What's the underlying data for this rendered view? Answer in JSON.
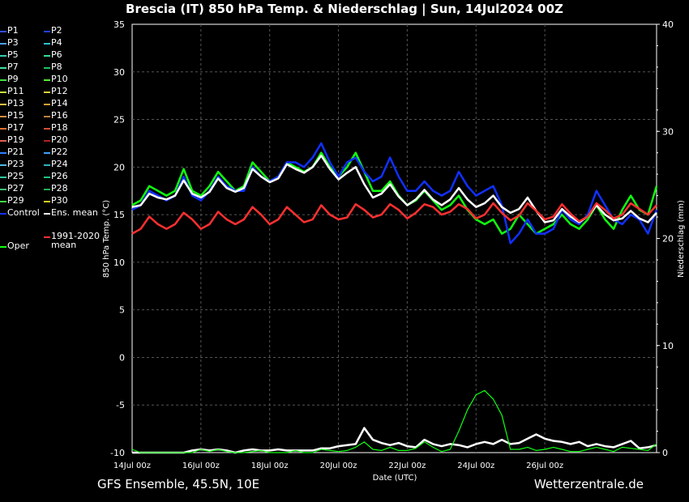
{
  "title": "Brescia  (IT)  850 hPa Temp. & Niederschlag | Sun, 14Jul2024 00Z",
  "footer": {
    "left": "GFS Ensemble, 45.5N, 10E",
    "right": "Wetterzentrale.de"
  },
  "legend": [
    {
      "name": "P1",
      "color": "#3050ff"
    },
    {
      "name": "P2",
      "color": "#2040e0"
    },
    {
      "name": "P3",
      "color": "#4aa0ff"
    },
    {
      "name": "P4",
      "color": "#30c0d0"
    },
    {
      "name": "P5",
      "color": "#30d0b0"
    },
    {
      "name": "P6",
      "color": "#30e090"
    },
    {
      "name": "P7",
      "color": "#40e0a0"
    },
    {
      "name": "P8",
      "color": "#20c060"
    },
    {
      "name": "P9",
      "color": "#40e040"
    },
    {
      "name": "P10",
      "color": "#50f030"
    },
    {
      "name": "P11",
      "color": "#c8e040"
    },
    {
      "name": "P12",
      "color": "#e0d040"
    },
    {
      "name": "P13",
      "color": "#e8c040"
    },
    {
      "name": "P14",
      "color": "#e0a030"
    },
    {
      "name": "P15",
      "color": "#e09040"
    },
    {
      "name": "P16",
      "color": "#c08040"
    },
    {
      "name": "P17",
      "color": "#e07030"
    },
    {
      "name": "P18",
      "color": "#d05030"
    },
    {
      "name": "P19",
      "color": "#e06050"
    },
    {
      "name": "P20",
      "color": "#b02020"
    },
    {
      "name": "P21",
      "color": "#3080ff"
    },
    {
      "name": "P22",
      "color": "#40a0ff"
    },
    {
      "name": "P23",
      "color": "#50b8e0"
    },
    {
      "name": "P24",
      "color": "#30b0c0"
    },
    {
      "name": "P25",
      "color": "#30c8a0"
    },
    {
      "name": "P26",
      "color": "#20c080"
    },
    {
      "name": "P27",
      "color": "#40c070"
    },
    {
      "name": "P28",
      "color": "#20b050"
    },
    {
      "name": "P29",
      "color": "#40e040"
    },
    {
      "name": "P30",
      "color": "#e0d020"
    },
    {
      "name": "Control",
      "color": "#1030ff"
    },
    {
      "name": "Ens. mean",
      "color": "#ffffff"
    },
    {
      "name": "Oper",
      "color": "#10ff10"
    },
    {
      "name": "1991-2020\nmean",
      "color": "#ff3030"
    }
  ],
  "chart_data": {
    "type": "line",
    "xlabel": "Date (UTC)",
    "ylabel": "850 hPa Temp. (°C)",
    "ylabel_right": "Niederschlag (mm)",
    "ylim": [
      -10,
      35
    ],
    "ylim_right": [
      0,
      40
    ],
    "yticks": [
      "35",
      "30",
      "25",
      "20",
      "15",
      "10",
      "5",
      "0",
      "-5",
      "-10"
    ],
    "yticks_right": [
      "40",
      "30",
      "20",
      "10",
      "0"
    ],
    "xticks": [
      "14Jul 00z",
      "16Jul 00z",
      "18Jul 00z",
      "20Jul 00z",
      "22Jul 00z",
      "24Jul 00z",
      "26Jul 00z"
    ],
    "x_start": "14Jul 00z",
    "x_step_hours": 6,
    "grid": true,
    "series": [
      {
        "name": "Oper",
        "color": "#10ff10",
        "values": [
          16.0,
          16.5,
          18.0,
          17.5,
          17.0,
          17.5,
          19.8,
          17.5,
          17.0,
          18.0,
          19.5,
          18.5,
          17.5,
          18.0,
          20.5,
          19.5,
          18.5,
          19.0,
          20.5,
          20.0,
          19.5,
          20.0,
          21.5,
          20.0,
          19.0,
          20.0,
          21.5,
          19.5,
          17.5,
          17.5,
          18.5,
          17.0,
          16.0,
          16.5,
          17.5,
          16.5,
          15.5,
          16.0,
          17.0,
          15.5,
          14.5,
          14.0,
          14.5,
          13.0,
          13.5,
          15.0,
          14.0,
          13.0,
          13.5,
          14.0,
          15.0,
          14.0,
          13.5,
          14.5,
          16.0,
          14.5,
          13.5,
          15.5,
          17.0,
          15.5,
          15.0,
          18.0
        ]
      },
      {
        "name": "Control",
        "color": "#1030ff",
        "values": [
          15.5,
          16.0,
          17.5,
          17.0,
          16.5,
          17.0,
          19.0,
          17.0,
          16.5,
          17.5,
          19.0,
          18.0,
          17.5,
          17.5,
          20.0,
          19.0,
          18.5,
          19.0,
          20.5,
          20.5,
          20.0,
          21.0,
          22.5,
          20.5,
          19.0,
          20.5,
          21.0,
          19.5,
          18.5,
          19.0,
          21.0,
          19.0,
          17.5,
          17.5,
          18.5,
          17.5,
          17.0,
          17.5,
          19.5,
          18.0,
          17.0,
          17.5,
          18.0,
          16.0,
          12.0,
          13.0,
          14.5,
          13.0,
          13.0,
          13.5,
          15.5,
          14.5,
          14.0,
          15.0,
          17.5,
          16.0,
          14.5,
          14.0,
          15.0,
          14.5,
          13.0,
          15.5
        ]
      },
      {
        "name": "Ens. mean",
        "color": "#ffffff",
        "values": [
          15.8,
          16.0,
          17.2,
          16.8,
          16.6,
          17.0,
          18.6,
          17.2,
          16.8,
          17.4,
          18.8,
          17.8,
          17.4,
          17.8,
          19.8,
          19.0,
          18.4,
          18.8,
          20.3,
          19.8,
          19.4,
          20.0,
          21.2,
          19.8,
          18.7,
          19.4,
          20.0,
          18.2,
          16.8,
          17.2,
          18.2,
          16.9,
          16.0,
          16.6,
          17.6,
          16.6,
          16.0,
          16.6,
          17.8,
          16.6,
          15.8,
          16.2,
          17.0,
          15.8,
          15.2,
          15.6,
          16.8,
          15.4,
          14.2,
          14.4,
          15.6,
          14.8,
          14.2,
          14.8,
          16.0,
          15.0,
          14.4,
          14.6,
          15.4,
          14.6,
          14.2,
          15.2
        ]
      },
      {
        "name": "1991-2020\nmean",
        "color": "#ff3030",
        "values": [
          13.0,
          13.5,
          14.8,
          14.0,
          13.5,
          14.0,
          15.2,
          14.5,
          13.5,
          14.0,
          15.3,
          14.5,
          14.0,
          14.5,
          15.8,
          15.0,
          14.0,
          14.5,
          15.8,
          15.0,
          14.2,
          14.5,
          16.0,
          15.0,
          14.5,
          14.7,
          16.1,
          15.5,
          14.7,
          15.0,
          16.1,
          15.5,
          14.6,
          15.2,
          16.1,
          15.8,
          15.0,
          15.3,
          16.1,
          15.6,
          14.6,
          15.0,
          16.2,
          15.2,
          14.4,
          14.9,
          16.2,
          15.4,
          14.5,
          14.8,
          16.1,
          15.1,
          14.3,
          14.8,
          16.2,
          15.5,
          14.6,
          15.0,
          16.2,
          15.6,
          15.0,
          16.0
        ]
      },
      {
        "name": "Niederschlag Ens. mean",
        "color": "#ffffff",
        "axis": "right",
        "values": [
          0,
          0,
          0,
          0,
          0,
          0,
          0,
          0.2,
          0.3,
          0.2,
          0.3,
          0.2,
          0,
          0.2,
          0.3,
          0.2,
          0.2,
          0.3,
          0.2,
          0.2,
          0.2,
          0.2,
          0.4,
          0.4,
          0.6,
          0.7,
          0.8,
          2.3,
          1.2,
          0.9,
          0.7,
          0.9,
          0.6,
          0.5,
          1.2,
          0.8,
          0.6,
          0.8,
          0.7,
          0.5,
          0.8,
          1.0,
          0.8,
          1.2,
          0.8,
          0.9,
          1.3,
          1.7,
          1.3,
          1.1,
          1.0,
          0.8,
          1.0,
          0.6,
          0.8,
          0.6,
          0.5,
          0.8,
          1.1,
          0.4,
          0.5,
          0.7
        ]
      },
      {
        "name": "Niederschlag Oper",
        "color": "#10ff10",
        "axis": "right",
        "values": [
          0.3,
          0,
          0,
          0,
          0,
          0,
          0,
          0,
          0.3,
          0.1,
          0.3,
          0.1,
          0,
          0,
          0.1,
          0.2,
          0,
          0,
          0,
          0.2,
          0,
          0,
          0.3,
          0.2,
          0.1,
          0.2,
          0.5,
          1.0,
          0.3,
          0.2,
          0.5,
          0.2,
          0.2,
          0.4,
          1.0,
          0.5,
          0.1,
          0.3,
          2.0,
          4.0,
          5.4,
          5.8,
          5.0,
          3.5,
          0.3,
          0.3,
          0.5,
          0.2,
          0.3,
          0.5,
          0.3,
          0.1,
          0.1,
          0.3,
          0.5,
          0.3,
          0.1,
          0.5,
          0.4,
          0.3,
          0.2,
          0.8
        ]
      }
    ]
  }
}
